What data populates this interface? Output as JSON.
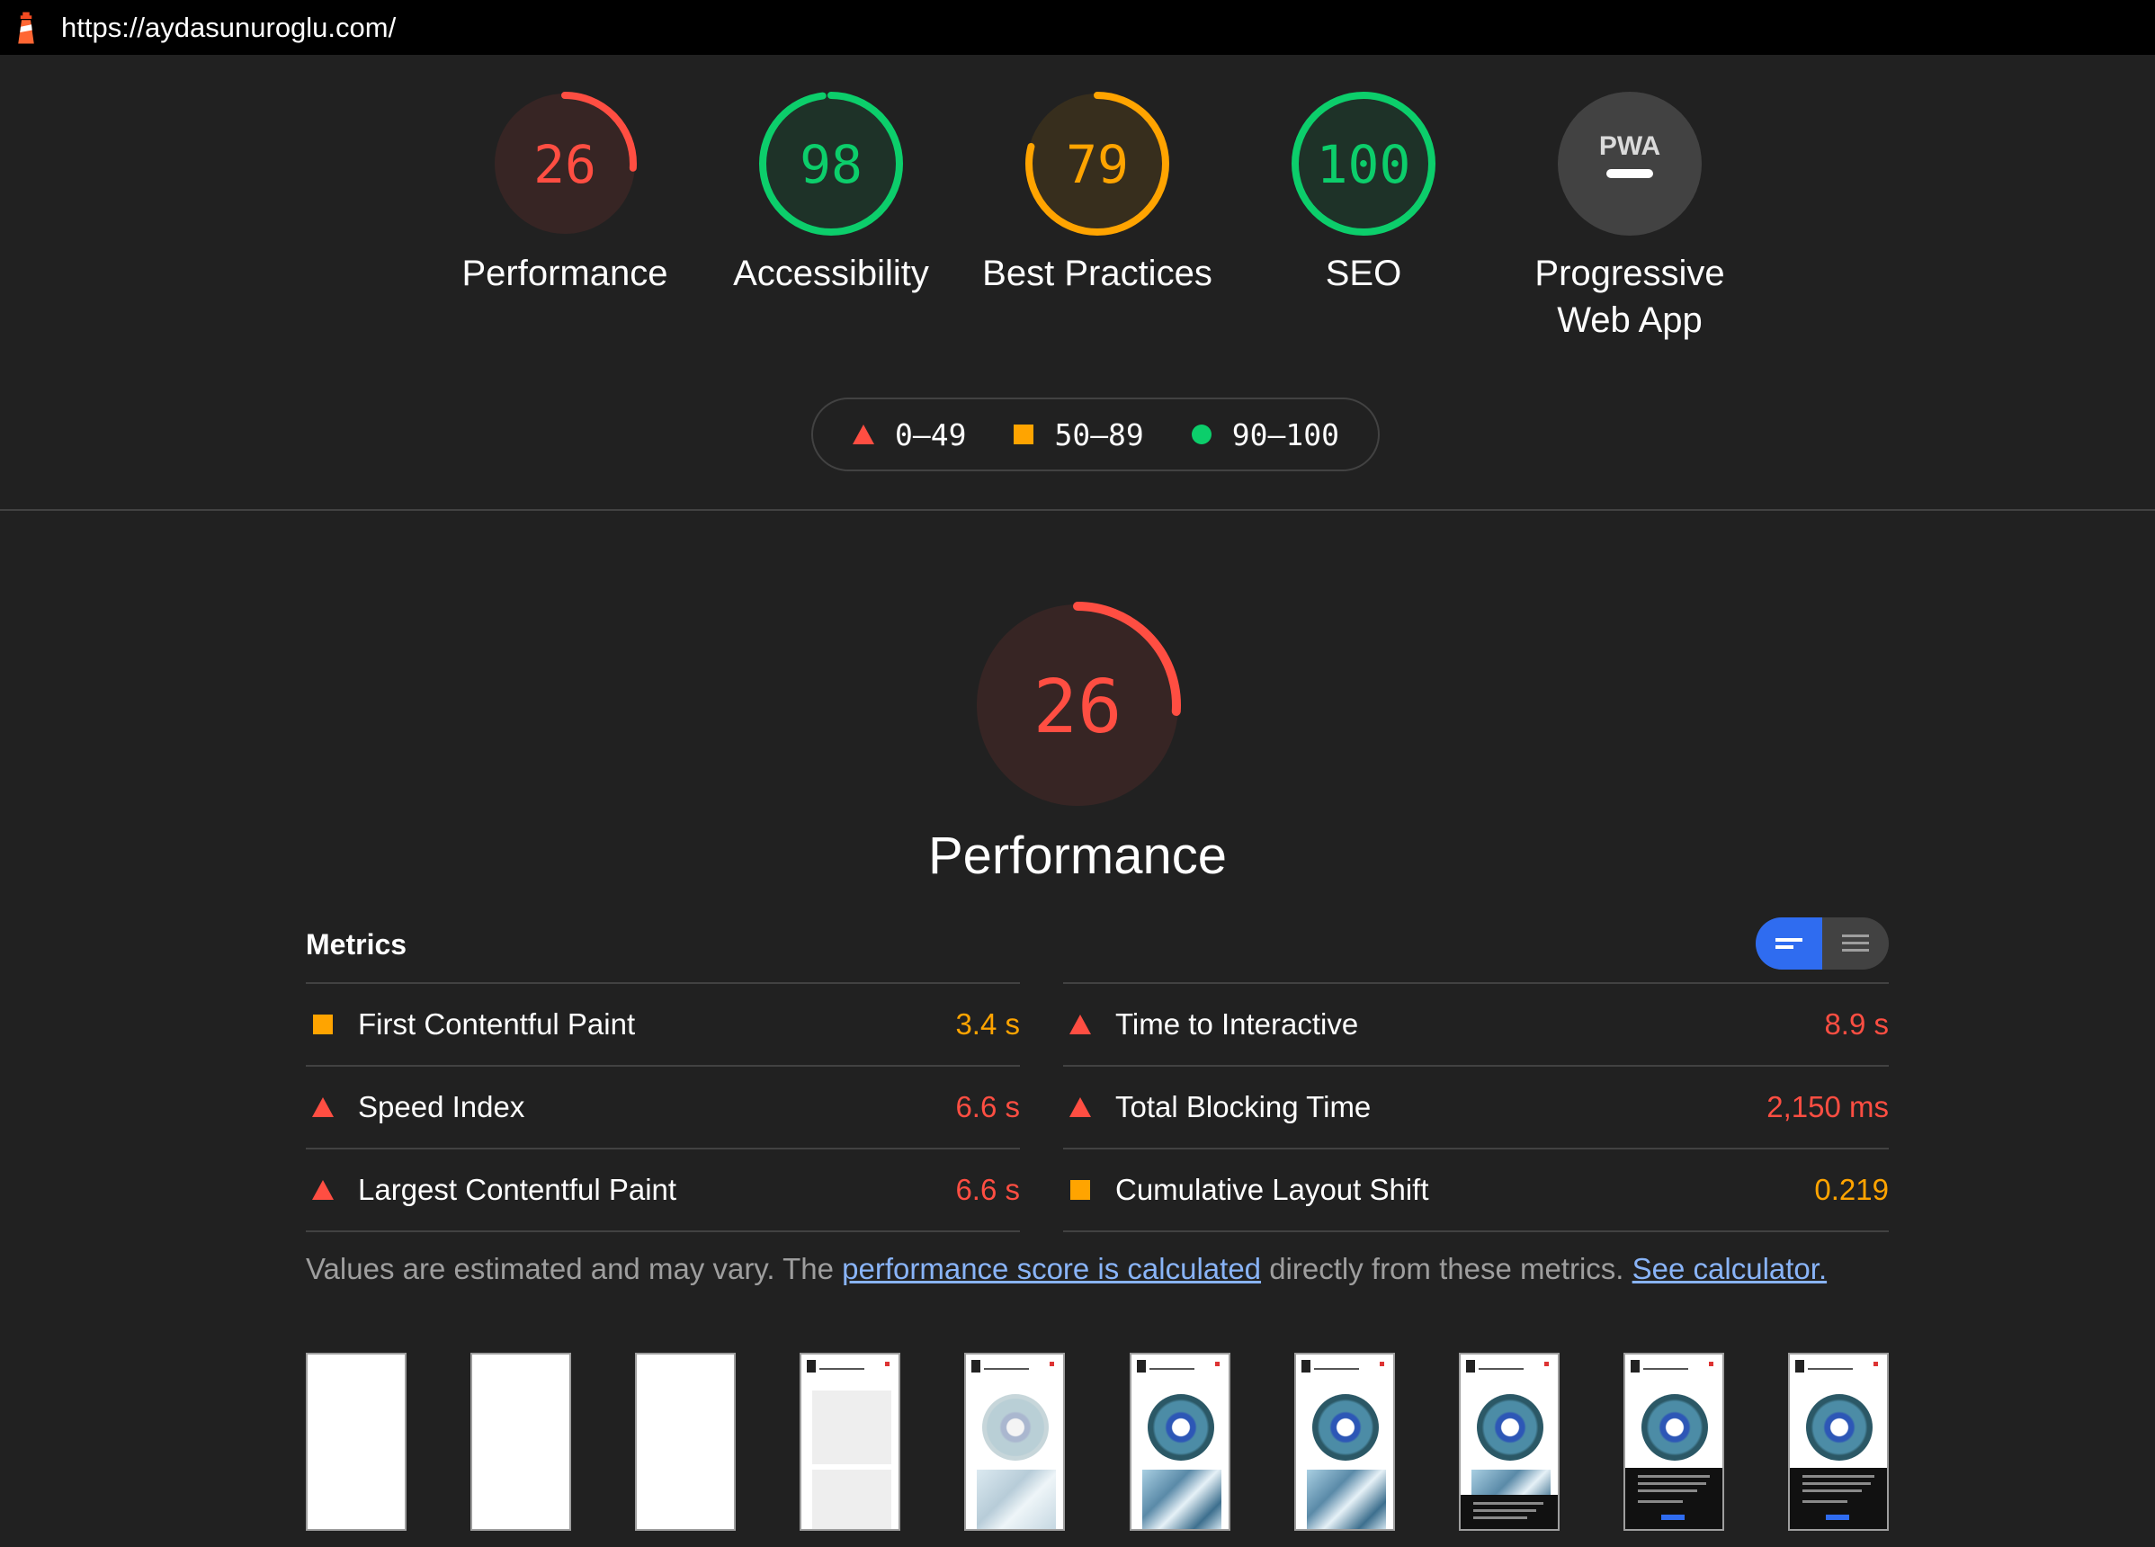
{
  "url": "https://aydasunuroglu.com/",
  "colors": {
    "fail": "#ff4e42",
    "average": "#ffa400",
    "pass": "#0cce6b",
    "pwa": "#424242",
    "toggle_active": "#2f6cf0"
  },
  "gauges": [
    {
      "score": "26",
      "value": 26,
      "label": "Performance",
      "rating": "fail"
    },
    {
      "score": "98",
      "value": 98,
      "label": "Accessibility",
      "rating": "pass"
    },
    {
      "score": "79",
      "value": 79,
      "label": "Best Practices",
      "rating": "average"
    },
    {
      "score": "100",
      "value": 100,
      "label": "SEO",
      "rating": "pass"
    },
    {
      "badge": "PWA",
      "label_line1": "Progressive",
      "label_line2": "Web App",
      "rating": "na"
    }
  ],
  "legend": [
    {
      "icon": "triangle-icon",
      "range": "0–49"
    },
    {
      "icon": "square-icon",
      "range": "50–89"
    },
    {
      "icon": "circle-icon",
      "range": "90–100"
    }
  ],
  "performance": {
    "score": "26",
    "value": 26,
    "title": "Performance"
  },
  "metrics": {
    "title": "Metrics",
    "left": [
      {
        "name": "First Contentful Paint",
        "value": "3.4 s",
        "rating": "average"
      },
      {
        "name": "Speed Index",
        "value": "6.6 s",
        "rating": "fail"
      },
      {
        "name": "Largest Contentful Paint",
        "value": "6.6 s",
        "rating": "fail"
      }
    ],
    "right": [
      {
        "name": "Time to Interactive",
        "value": "8.9 s",
        "rating": "fail"
      },
      {
        "name": "Total Blocking Time",
        "value": "2,150 ms",
        "rating": "fail"
      },
      {
        "name": "Cumulative Layout Shift",
        "value": "0.219",
        "rating": "average"
      }
    ]
  },
  "note": {
    "text1": "Values are estimated and may vary. The ",
    "link1": "performance score is calculated",
    "text2": " directly from these metrics. ",
    "link2": "See calculator."
  },
  "filmstrip": [
    {
      "state": "blank"
    },
    {
      "state": "blank"
    },
    {
      "state": "blank"
    },
    {
      "state": "placeholders"
    },
    {
      "state": "faint"
    },
    {
      "state": "loaded"
    },
    {
      "state": "loaded"
    },
    {
      "state": "banner-low"
    },
    {
      "state": "banner-high"
    },
    {
      "state": "banner-high"
    }
  ]
}
